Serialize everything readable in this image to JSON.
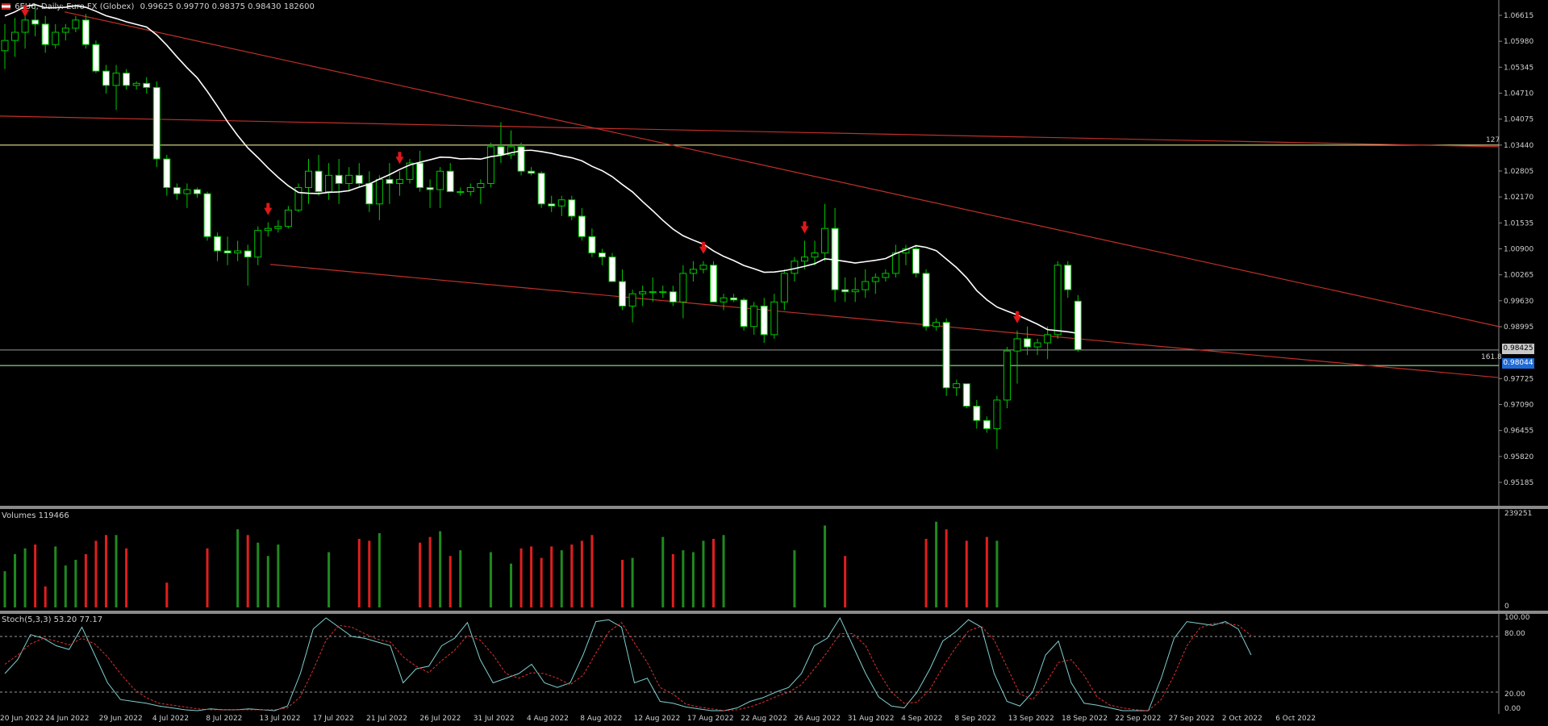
{
  "header": {
    "symbol": "6EU6",
    "timeframe": "Daily",
    "instrument": "Euro FX (Globex)",
    "ohlcv": "0.99625 0.99770 0.98375 0.98430 182600"
  },
  "price_axis": {
    "labels": [
      "1.06615",
      "1.05980",
      "1.05345",
      "1.04710",
      "1.04075",
      "1.03440",
      "1.02805",
      "1.02170",
      "1.01535",
      "1.00900",
      "1.00265",
      "0.99630",
      "0.98995",
      "0.98425",
      "0.98044",
      "0.97725",
      "0.97090",
      "0.96455",
      "0.95820",
      "0.95185"
    ],
    "bid_tag": "0.98425",
    "ask_tag": "0.98044",
    "ask_tag_color": "#1e6ad6"
  },
  "fib_levels": {
    "upper": "127",
    "lower": "161.8"
  },
  "volume_panel": {
    "title": "Volumes 119466",
    "max_label": "239251",
    "min_label": "0"
  },
  "stoch_panel": {
    "title": "Stoch(5,3,3) 53.20 77.17",
    "levels": [
      "100.00",
      "80.00",
      "20.00",
      "0.00"
    ]
  },
  "date_axis": [
    "20 Jun 2022",
    "24 Jun 2022",
    "29 Jun 2022",
    "4 Jul 2022",
    "8 Jul 2022",
    "13 Jul 2022",
    "17 Jul 2022",
    "21 Jul 2022",
    "26 Jul 2022",
    "31 Jul 2022",
    "4 Aug 2022",
    "8 Aug 2022",
    "12 Aug 2022",
    "17 Aug 2022",
    "22 Aug 2022",
    "26 Aug 2022",
    "31 Aug 2022",
    "4 Sep 2022",
    "8 Sep 2022",
    "13 Sep 2022",
    "18 Sep 2022",
    "22 Sep 2022",
    "27 Sep 2022",
    "2 Oct 2022",
    "6 Oct 2022"
  ],
  "colors": {
    "up_candle": "#000000",
    "down_candle": "#ffffff",
    "wick": "#00c800",
    "ma": "#ffffff",
    "trend": "#c0302a",
    "vol_up": "#1f8a1f",
    "vol_down": "#e11e1e",
    "stoch_main": "#7fcfcf",
    "stoch_signal": "#e03030"
  },
  "chart_data": {
    "type": "candlestick",
    "candles": [
      [
        1.0575,
        1.064,
        1.053,
        1.06
      ],
      [
        1.06,
        1.0655,
        1.056,
        1.062
      ],
      [
        1.062,
        1.0665,
        1.058,
        1.065
      ],
      [
        1.065,
        1.068,
        1.061,
        1.064
      ],
      [
        1.064,
        1.066,
        1.057,
        1.059
      ],
      [
        1.059,
        1.064,
        1.058,
        1.062
      ],
      [
        1.062,
        1.064,
        1.06,
        1.063
      ],
      [
        1.063,
        1.066,
        1.062,
        1.065
      ],
      [
        1.065,
        1.0665,
        1.058,
        1.059
      ],
      [
        1.059,
        1.06,
        1.052,
        1.0525
      ],
      [
        1.0525,
        1.054,
        1.047,
        1.049
      ],
      [
        1.049,
        1.054,
        1.043,
        1.052
      ],
      [
        1.052,
        1.053,
        1.048,
        1.049
      ],
      [
        1.049,
        1.05,
        1.048,
        1.0495
      ],
      [
        1.0495,
        1.051,
        1.047,
        1.0485
      ],
      [
        1.0485,
        1.05,
        1.029,
        1.031
      ],
      [
        1.031,
        1.032,
        1.022,
        1.024
      ],
      [
        1.024,
        1.025,
        1.021,
        1.0225
      ],
      [
        1.0225,
        1.025,
        1.019,
        1.0235
      ],
      [
        1.0235,
        1.024,
        1.0215,
        1.0225
      ],
      [
        1.0225,
        1.023,
        1.011,
        1.012
      ],
      [
        1.012,
        1.013,
        1.006,
        1.0085
      ],
      [
        1.0085,
        1.012,
        1.005,
        1.008
      ],
      [
        1.008,
        1.011,
        1.006,
        1.0085
      ],
      [
        1.0085,
        1.01,
        1.0,
        1.007
      ],
      [
        1.007,
        1.0145,
        1.005,
        1.0135
      ],
      [
        1.0135,
        1.0155,
        1.012,
        1.014
      ],
      [
        1.014,
        1.016,
        1.013,
        1.0145
      ],
      [
        1.0145,
        1.0195,
        1.014,
        1.0185
      ],
      [
        1.0185,
        1.025,
        1.018,
        1.024
      ],
      [
        1.024,
        1.031,
        1.02,
        1.028
      ],
      [
        1.028,
        1.032,
        1.022,
        1.023
      ],
      [
        1.023,
        1.03,
        1.021,
        1.027
      ],
      [
        1.027,
        1.031,
        1.02,
        1.025
      ],
      [
        1.025,
        1.029,
        1.023,
        1.027
      ],
      [
        1.027,
        1.03,
        1.024,
        1.025
      ],
      [
        1.025,
        1.028,
        1.018,
        1.02
      ],
      [
        1.02,
        1.027,
        1.016,
        1.026
      ],
      [
        1.026,
        1.03,
        1.02,
        1.025
      ],
      [
        1.025,
        1.028,
        1.022,
        1.026
      ],
      [
        1.026,
        1.031,
        1.025,
        1.03
      ],
      [
        1.03,
        1.033,
        1.023,
        1.024
      ],
      [
        1.024,
        1.026,
        1.019,
        1.0235
      ],
      [
        1.0235,
        1.029,
        1.019,
        1.028
      ],
      [
        1.028,
        1.03,
        1.023,
        1.023
      ],
      [
        1.023,
        1.024,
        1.022,
        1.023
      ],
      [
        1.023,
        1.025,
        1.022,
        1.024
      ],
      [
        1.024,
        1.026,
        1.02,
        1.025
      ],
      [
        1.025,
        1.035,
        1.024,
        1.034
      ],
      [
        1.034,
        1.04,
        1.03,
        1.032
      ],
      [
        1.032,
        1.038,
        1.031,
        1.034
      ],
      [
        1.034,
        1.035,
        1.027,
        1.028
      ],
      [
        1.028,
        1.029,
        1.027,
        1.0275
      ],
      [
        1.0275,
        1.028,
        1.019,
        1.02
      ],
      [
        1.02,
        1.022,
        1.018,
        1.0195
      ],
      [
        1.0195,
        1.022,
        1.017,
        1.021
      ],
      [
        1.021,
        1.022,
        1.016,
        1.017
      ],
      [
        1.017,
        1.019,
        1.011,
        1.012
      ],
      [
        1.012,
        1.014,
        1.007,
        1.008
      ],
      [
        1.008,
        1.009,
        1.005,
        1.007
      ],
      [
        1.007,
        1.008,
        1.001,
        1.001
      ],
      [
        1.001,
        1.004,
        0.994,
        0.995
      ],
      [
        0.995,
        0.999,
        0.991,
        0.998
      ],
      [
        0.998,
        1.0,
        0.995,
        0.9985
      ],
      [
        0.9985,
        1.002,
        0.996,
        0.9985
      ],
      [
        0.9985,
        1.0,
        0.997,
        0.9985
      ],
      [
        0.9985,
        1.0,
        0.995,
        0.996
      ],
      [
        0.996,
        1.005,
        0.992,
        1.003
      ],
      [
        1.003,
        1.006,
        1.001,
        1.004
      ],
      [
        1.004,
        1.006,
        1.003,
        1.005
      ],
      [
        1.005,
        1.006,
        0.996,
        0.996
      ],
      [
        0.996,
        0.998,
        0.994,
        0.997
      ],
      [
        0.997,
        0.998,
        0.996,
        0.9965
      ],
      [
        0.9965,
        0.997,
        0.989,
        0.99
      ],
      [
        0.99,
        0.996,
        0.988,
        0.995
      ],
      [
        0.995,
        0.997,
        0.986,
        0.988
      ],
      [
        0.988,
        0.998,
        0.987,
        0.996
      ],
      [
        0.996,
        1.004,
        0.994,
        1.003
      ],
      [
        1.003,
        1.007,
        1.001,
        1.006
      ],
      [
        1.006,
        1.011,
        1.004,
        1.007
      ],
      [
        1.007,
        1.011,
        1.005,
        1.008
      ],
      [
        1.008,
        1.02,
        1.006,
        1.014
      ],
      [
        1.014,
        1.019,
        0.996,
        0.999
      ],
      [
        0.999,
        1.002,
        0.996,
        0.9985
      ],
      [
        0.9985,
        1.002,
        0.996,
        0.999
      ],
      [
        0.999,
        1.004,
        0.997,
        1.001
      ],
      [
        1.001,
        1.003,
        0.998,
        1.002
      ],
      [
        1.002,
        1.004,
        1.001,
        1.003
      ],
      [
        1.003,
        1.01,
        1.002,
        1.008
      ],
      [
        1.008,
        1.01,
        1.005,
        1.009
      ],
      [
        1.009,
        1.01,
        1.002,
        1.003
      ],
      [
        1.003,
        1.004,
        0.989,
        0.99
      ],
      [
        0.99,
        0.992,
        0.989,
        0.991
      ],
      [
        0.991,
        0.992,
        0.973,
        0.975
      ],
      [
        0.975,
        0.977,
        0.973,
        0.976
      ],
      [
        0.976,
        0.976,
        0.97,
        0.9705
      ],
      [
        0.9705,
        0.972,
        0.965,
        0.967
      ],
      [
        0.967,
        0.968,
        0.964,
        0.965
      ],
      [
        0.965,
        0.973,
        0.96,
        0.972
      ],
      [
        0.972,
        0.985,
        0.97,
        0.984
      ],
      [
        0.984,
        0.989,
        0.976,
        0.987
      ],
      [
        0.987,
        0.99,
        0.983,
        0.985
      ],
      [
        0.985,
        0.987,
        0.983,
        0.986
      ],
      [
        0.986,
        0.99,
        0.982,
        0.988
      ],
      [
        0.988,
        1.006,
        0.987,
        1.005
      ],
      [
        1.005,
        1.006,
        0.997,
        0.999
      ],
      [
        0.9962,
        0.9977,
        0.9838,
        0.9843
      ]
    ],
    "signal_arrows_at_bars": [
      2,
      26,
      39,
      69,
      79,
      100
    ],
    "volumes": [
      95000,
      140000,
      155000,
      165000,
      55000,
      160000,
      110000,
      125000,
      140000,
      175000,
      190000,
      190000,
      155000,
      0,
      0,
      0,
      65000,
      0,
      0,
      0,
      155000,
      0,
      0,
      205000,
      190000,
      170000,
      135000,
      165000,
      0,
      0,
      0,
      0,
      145000,
      0,
      0,
      180000,
      175000,
      195000,
      0,
      0,
      0,
      170000,
      185000,
      200000,
      135000,
      150000,
      0,
      0,
      145000,
      0,
      115000,
      155000,
      160000,
      130000,
      160000,
      150000,
      165000,
      175000,
      190000,
      0,
      0,
      125000,
      130000,
      0,
      0,
      185000,
      140000,
      150000,
      145000,
      175000,
      180000,
      190000,
      0,
      0,
      0,
      0,
      0,
      0,
      150000,
      0,
      0,
      215000,
      0,
      135000,
      0,
      0,
      0,
      0,
      0,
      0,
      0,
      180000,
      225000,
      205000,
      0,
      175000,
      0,
      185000,
      175000,
      0,
      0,
      0,
      0,
      0,
      0,
      0,
      0,
      0,
      0,
      0,
      0,
      0,
      0,
      0,
      0,
      0,
      0,
      0,
      0,
      0,
      0,
      0
    ],
    "volume_colors": [
      "up",
      "up",
      "up",
      "up",
      "down",
      "up",
      "up",
      "up",
      "up",
      "up",
      "up",
      "up",
      "down",
      "up",
      "up",
      "up",
      "up",
      "up",
      "up",
      "up",
      "down",
      "up",
      "up",
      "down",
      "down",
      "up",
      "up",
      "down",
      "up",
      "up",
      "up",
      "up",
      "up",
      "up",
      "up",
      "up",
      "up",
      "up",
      "up",
      "up",
      "up",
      "up",
      "up",
      "up",
      "up",
      "up",
      "up",
      "up",
      "up",
      "up",
      "up",
      "up",
      "up",
      "up",
      "up",
      "up",
      "up",
      "up",
      "up",
      "up",
      "up",
      "up",
      "up",
      "up",
      "up",
      "up",
      "up",
      "up",
      "up",
      "up",
      "up",
      "up",
      "up",
      "up",
      "up",
      "up",
      "up",
      "up",
      "up",
      "up",
      "up",
      "up",
      "up",
      "up",
      "up",
      "up",
      "up",
      "up",
      "up",
      "up",
      "up",
      "up",
      "up",
      "up",
      "up",
      "up",
      "up",
      "up",
      "up",
      "up",
      "up",
      "up",
      "up",
      "up",
      "up",
      "up",
      "up",
      "up",
      "up",
      "up",
      "up",
      "up",
      "up",
      "up",
      "up",
      "up",
      "up",
      "up",
      "up"
    ],
    "stoch_main": [
      40,
      55,
      82,
      78,
      70,
      66,
      90,
      60,
      30,
      12,
      10,
      8,
      5,
      3,
      1,
      0,
      2,
      1,
      1,
      2,
      1,
      0,
      5,
      40,
      88,
      100,
      90,
      80,
      78,
      74,
      70,
      30,
      45,
      48,
      70,
      78,
      95,
      55,
      30,
      35,
      40,
      50,
      30,
      25,
      30,
      60,
      96,
      98,
      90,
      30,
      35,
      10,
      8,
      4,
      2,
      0,
      0,
      3,
      10,
      14,
      20,
      25,
      40,
      70,
      78,
      100,
      70,
      40,
      15,
      5,
      3,
      20,
      45,
      75,
      85,
      98,
      90,
      40,
      10,
      5,
      20,
      60,
      75,
      30,
      8,
      6,
      3,
      0,
      0,
      0,
      35,
      78,
      96,
      94,
      92,
      96,
      88,
      60
    ],
    "stoch_signal": [
      50,
      60,
      72,
      78,
      75,
      71,
      78,
      72,
      58,
      40,
      24,
      14,
      8,
      6,
      4,
      2,
      1,
      1,
      1,
      1,
      1,
      1,
      3,
      15,
      44,
      76,
      92,
      90,
      83,
      77,
      74,
      58,
      48,
      41,
      54,
      65,
      81,
      76,
      60,
      40,
      35,
      41,
      40,
      35,
      28,
      38,
      62,
      85,
      95,
      73,
      52,
      25,
      18,
      7,
      4,
      2,
      0,
      1,
      4,
      9,
      15,
      20,
      28,
      45,
      63,
      83,
      83,
      70,
      42,
      20,
      8,
      9,
      23,
      47,
      68,
      86,
      91,
      76,
      47,
      18,
      12,
      29,
      52,
      55,
      38,
      15,
      6,
      3,
      1,
      0,
      12,
      38,
      70,
      89,
      94,
      94,
      92,
      81
    ]
  }
}
